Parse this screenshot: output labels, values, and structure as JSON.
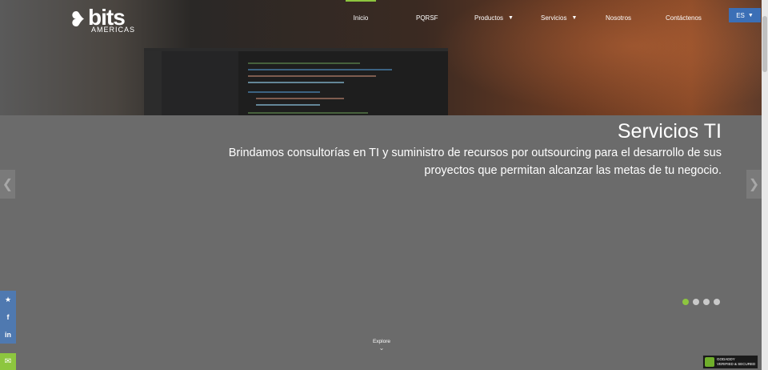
{
  "brand": {
    "logo_word": "bits",
    "logo_sub": "AMERICAS"
  },
  "nav": {
    "items": [
      {
        "label": "Inicio",
        "active": true
      },
      {
        "label": "PQRSF"
      },
      {
        "label": "Productos",
        "dropdown": true
      },
      {
        "label": "Servicios",
        "dropdown": true
      },
      {
        "label": "Nosotros"
      },
      {
        "label": "Contáctenos"
      }
    ],
    "language": "ES"
  },
  "hero": {
    "title": "Servicios TI",
    "description": "Brindamos consultorías en TI y suministro de recursos por outsourcing para el desarrollo de sus proyectos que permitan alcanzar las metas de tu negocio.",
    "slides_count": 4,
    "active_slide": 1
  },
  "explore": {
    "label": "Explore"
  },
  "badge": {
    "line1": "VERIFIED & SECURED",
    "line2": "GODADDY"
  },
  "colors": {
    "accent": "#8dc63f",
    "social": "#4f79b0",
    "lang": "#3b6fb6"
  },
  "icons": {
    "twitter": "twitter-icon",
    "facebook": "facebook-icon",
    "linkedin": "linkedin-icon",
    "mail": "mail-icon"
  }
}
